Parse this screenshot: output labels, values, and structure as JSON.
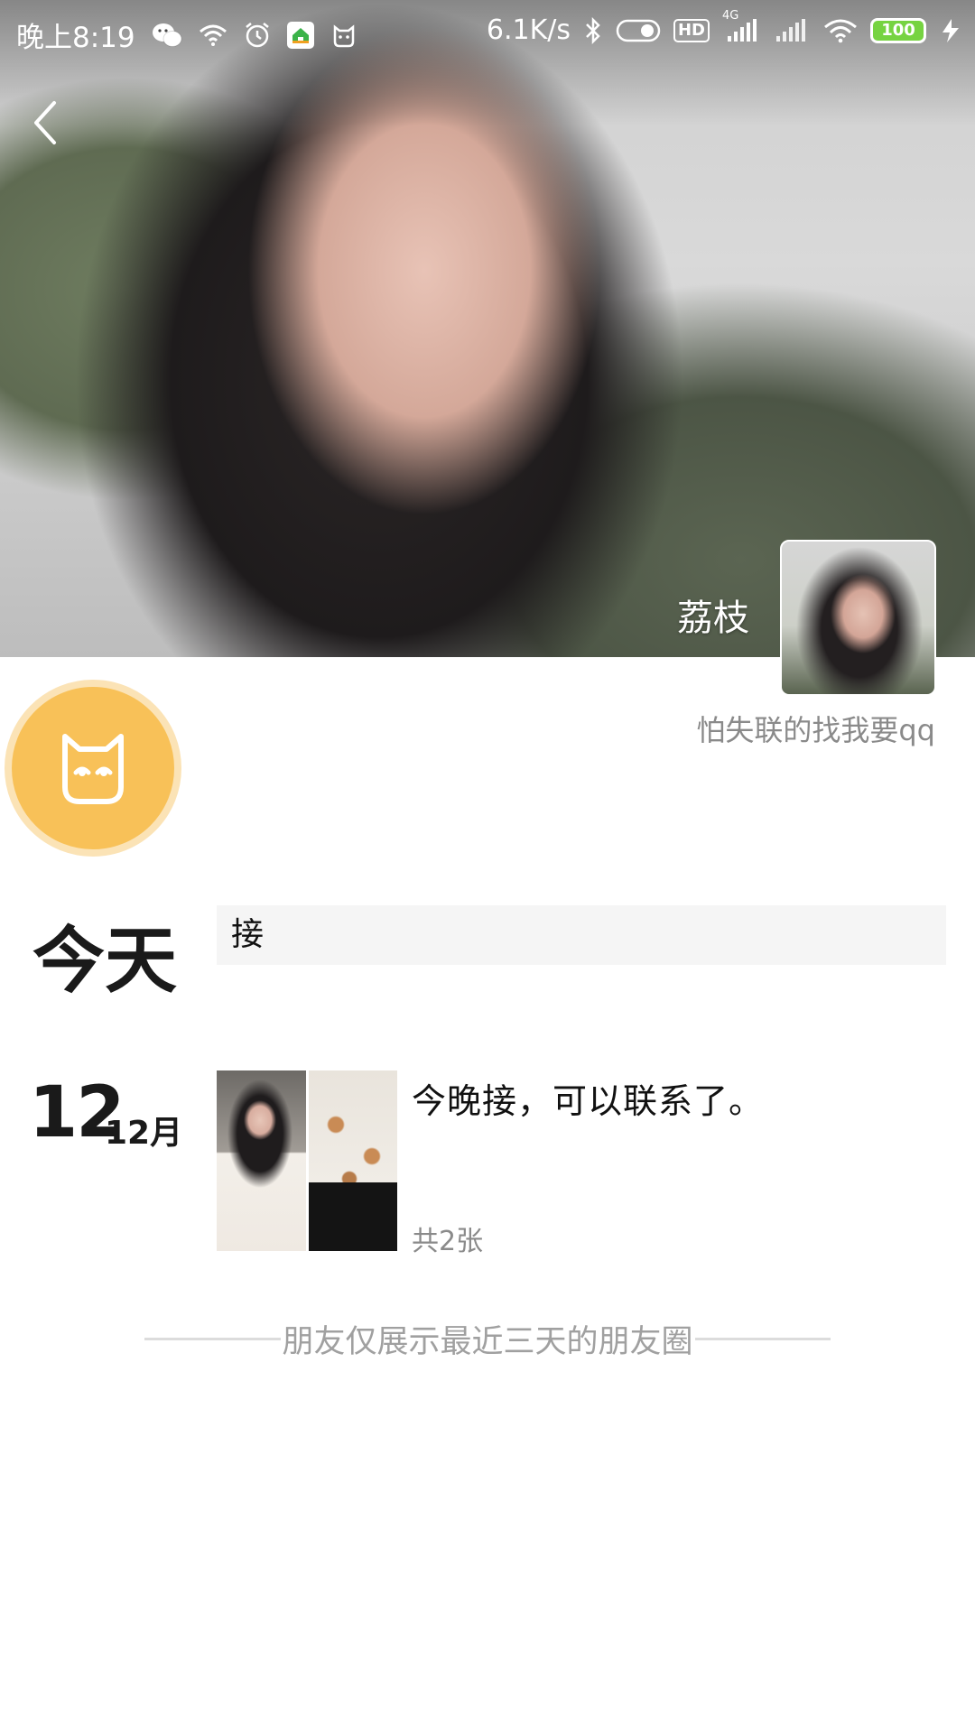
{
  "status_bar": {
    "time": "晚上8:19",
    "network_speed": "6.1K/s",
    "hd_label": "HD",
    "network_type": "4G",
    "battery_level": "100",
    "icons": [
      "wechat-icon",
      "wifi-icon",
      "alarm-icon",
      "app-home-icon",
      "cat-app-icon",
      "bluetooth-icon",
      "toggle-icon",
      "signal-icon",
      "signal-icon",
      "wifi-icon",
      "battery-icon",
      "charging-icon"
    ]
  },
  "header": {
    "back_icon": "chevron-left-icon"
  },
  "profile": {
    "name": "荔枝",
    "signature": "怕失联的找我要qq"
  },
  "app_logo": {
    "icon": "cat-face-icon",
    "color": "#f8c158"
  },
  "today": {
    "label": "今天",
    "input_value": "接"
  },
  "posts": [
    {
      "day": "12",
      "month": "12月",
      "text": "今晚接，可以联系了。",
      "image_count_label": "共2张"
    }
  ],
  "footer": {
    "note": "朋友仅展示最近三天的朋友圈"
  }
}
